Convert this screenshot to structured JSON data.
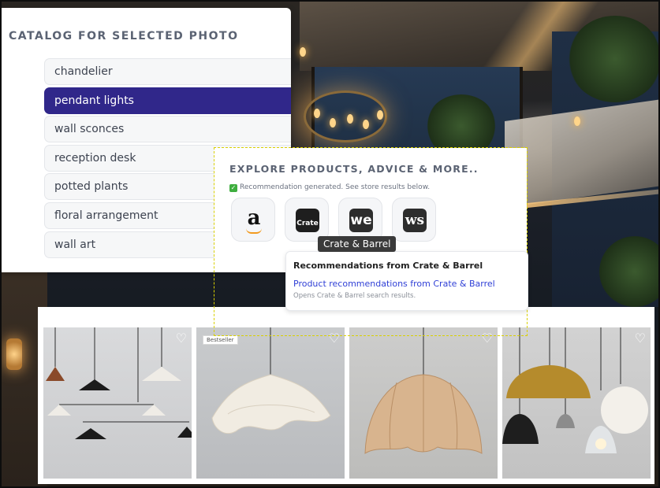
{
  "catalog": {
    "title": "CATALOG FOR SELECTED PHOTO",
    "items": [
      {
        "label": "chandelier",
        "active": false
      },
      {
        "label": "pendant lights",
        "active": true
      },
      {
        "label": "wall sconces",
        "active": false
      },
      {
        "label": "reception desk",
        "active": false
      },
      {
        "label": "potted plants",
        "active": false
      },
      {
        "label": "floral arrangement",
        "active": false
      },
      {
        "label": "wall art",
        "active": false
      }
    ]
  },
  "explore": {
    "title": "EXPLORE PRODUCTS, ADVICE & MORE..",
    "status": "Recommendation generated. See store results below.",
    "stores": [
      {
        "logo_text": "a",
        "icon": "amazon-icon"
      },
      {
        "logo_text": "Crate",
        "icon": "crate-and-barrel-icon"
      },
      {
        "logo_text": "we",
        "icon": "west-elm-icon"
      },
      {
        "logo_text": "ws",
        "icon": "williams-sonoma-icon"
      }
    ],
    "tooltip": "Crate & Barrel",
    "recommendation": {
      "heading": "Recommendations from Crate & Barrel",
      "link": "Product recommendations from Crate & Barrel",
      "subtext": "Opens Crate & Barrel search results."
    }
  },
  "products": {
    "badge": "Bestseller",
    "tiles": [
      {
        "icon": "cone-pendant-chandelier-icon"
      },
      {
        "icon": "wavy-fabric-pendant-icon"
      },
      {
        "icon": "linen-dome-pendant-icon"
      },
      {
        "icon": "brass-globe-pendants-icon"
      }
    ]
  },
  "colors": {
    "accent": "#30278a",
    "link": "#2f3fd6",
    "tooltip_bg": "#3a3a3a"
  }
}
